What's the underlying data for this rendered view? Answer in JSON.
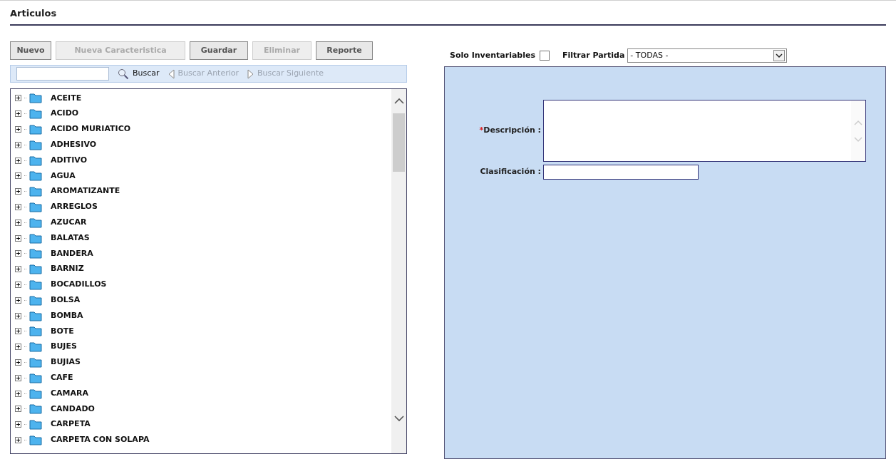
{
  "title": "Articulos",
  "buttons": [
    {
      "label": "Nuevo",
      "disabled": false
    },
    {
      "label": "Nueva Caracteristica",
      "disabled": true
    },
    {
      "label": "Guardar",
      "disabled": false
    },
    {
      "label": "Eliminar",
      "disabled": true
    },
    {
      "label": "Reporte",
      "disabled": false
    }
  ],
  "search": {
    "buttons": [
      {
        "label": "Buscar",
        "kind": "search",
        "disabled": false
      },
      {
        "label": "Buscar Anterior",
        "kind": "prev",
        "disabled": true
      },
      {
        "label": "Buscar Siguiente",
        "kind": "next",
        "disabled": true
      }
    ]
  },
  "tree": {
    "items": [
      {
        "label": "ACEITE",
        "expanded": false
      },
      {
        "label": "ACIDO",
        "expanded": false
      },
      {
        "label": "ACIDO MURIATICO",
        "expanded": false
      },
      {
        "label": "ADHESIVO",
        "expanded": false
      },
      {
        "label": "ADITIVO",
        "expanded": false
      },
      {
        "label": "AGUA",
        "expanded": false
      },
      {
        "label": "AROMATIZANTE",
        "expanded": false
      },
      {
        "label": "ARREGLOS",
        "expanded": false
      },
      {
        "label": "AZUCAR",
        "expanded": false
      },
      {
        "label": "BALATAS",
        "expanded": false
      },
      {
        "label": "BANDERA",
        "expanded": false
      },
      {
        "label": "BARNIZ",
        "expanded": false
      },
      {
        "label": "BOCADILLOS",
        "expanded": false
      },
      {
        "label": "BOLSA",
        "expanded": false
      },
      {
        "label": "BOMBA",
        "expanded": false
      },
      {
        "label": "BOTE",
        "expanded": false
      },
      {
        "label": "BUJES",
        "expanded": false
      },
      {
        "label": "BUJIAS",
        "expanded": false
      },
      {
        "label": "CAFE",
        "expanded": false
      },
      {
        "label": "CAMARA",
        "expanded": false
      },
      {
        "label": "CANDADO",
        "expanded": false
      },
      {
        "label": "CARPETA",
        "expanded": false
      },
      {
        "label": "CARPETA CON SOLAPA",
        "expanded": false
      }
    ]
  },
  "filters": {
    "solo_inventariables": {
      "label": "Solo Inventariables",
      "checked": false
    },
    "filtrar_partida": {
      "label": "Filtrar Partida",
      "value": "- TODAS -"
    }
  },
  "form": {
    "fields": [
      {
        "label": "Descripción :",
        "required_mark": "*",
        "kind": "textarea"
      },
      {
        "label": "Clasificación :",
        "kind": "text"
      }
    ]
  }
}
